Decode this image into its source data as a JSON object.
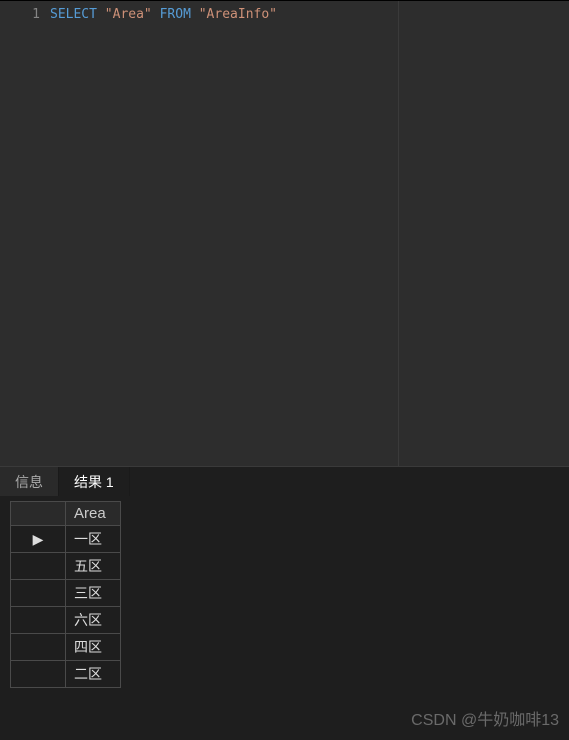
{
  "editor": {
    "line_number": "1",
    "sql": {
      "keyword1": "SELECT",
      "string1": "\"Area\"",
      "keyword2": "FROM",
      "string2": "\"AreaInfo\""
    }
  },
  "tabs": {
    "info": "信息",
    "results": "结果 1"
  },
  "results": {
    "column_header": "Area",
    "rows": [
      "一区",
      "五区",
      "三区",
      "六区",
      "四区",
      "二区"
    ],
    "active_row_indicator": "▶"
  },
  "watermark": "CSDN @牛奶咖啡13"
}
